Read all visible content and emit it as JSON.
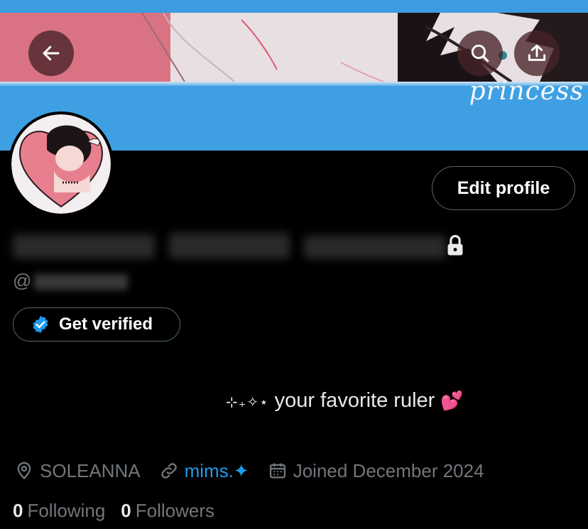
{
  "header": {
    "back_icon": "arrow-left-icon",
    "search_icon": "search-icon",
    "share_icon": "share-upload-icon",
    "banner_script": "princess"
  },
  "profile": {
    "edit_label": "Edit profile",
    "handle_prefix": "@",
    "lock_icon": "lock-icon",
    "verify_label": "Get verified",
    "verify_icon": "verified-badge-icon",
    "bio_sparkle": "⊹₊✧⋆",
    "bio_text": "your favorite ruler",
    "bio_emoji": "💕"
  },
  "meta": {
    "location_icon": "location-pin-icon",
    "location": "SOLEANNA",
    "link_icon": "link-icon",
    "link": "mims.✦",
    "calendar_icon": "calendar-icon",
    "joined": "Joined December 2024"
  },
  "stats": {
    "following_count": "0",
    "following_label": "Following",
    "followers_count": "0",
    "followers_label": "Followers"
  },
  "colors": {
    "accent": "#1d9bf0",
    "banner_blue": "#3ea0e3",
    "muted": "#71767b"
  }
}
